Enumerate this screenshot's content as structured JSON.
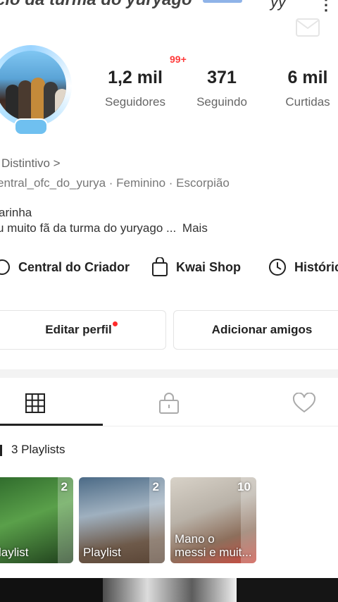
{
  "header": {
    "title_fragment": "cio da turma do yuryago",
    "scribble": "yy",
    "menu_glyph": "⋮"
  },
  "profile": {
    "avatar_notification": "99+",
    "stats": [
      {
        "value": "1,2 mil",
        "label": "Seguidores"
      },
      {
        "value": "371",
        "label": "Seguindo"
      },
      {
        "value": "6 mil",
        "label": "Curtidas"
      }
    ],
    "distintivo": "Distintivo >",
    "meta_line": "entral_ofc_do_yurya · Feminino · Escorpião",
    "bio_name": "arinha",
    "bio_text": "u muito fã da turma do yuryago ...",
    "bio_more": "Mais"
  },
  "quick_links": [
    {
      "label": "Central do Criador",
      "icon": "circle-icon"
    },
    {
      "label": "Kwai Shop",
      "icon": "shopping-bag-icon"
    },
    {
      "label": "Históric",
      "icon": "clock-icon"
    }
  ],
  "buttons": {
    "edit_profile": "Editar perfil",
    "add_friends": "Adicionar amigos"
  },
  "tabs": [
    {
      "icon": "grid-icon",
      "active": true
    },
    {
      "icon": "lock-icon",
      "active": false
    },
    {
      "icon": "heart-icon",
      "active": false
    }
  ],
  "playlists": {
    "label": "3 Playlists",
    "items": [
      {
        "title": "laylist",
        "count": "2"
      },
      {
        "title": "Playlist",
        "count": "2"
      },
      {
        "title": "Mano o\nmessi e muit...",
        "count": "10"
      }
    ]
  },
  "colors": {
    "accent_red": "#ff2a2a",
    "text_primary": "#222222",
    "text_secondary": "#666666"
  }
}
